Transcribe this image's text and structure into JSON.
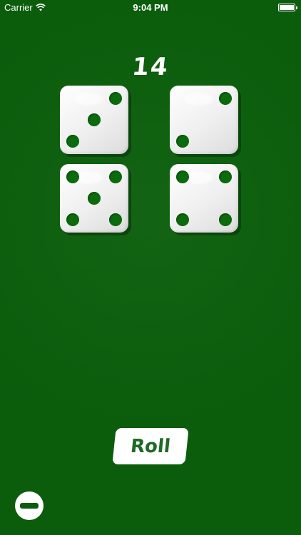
{
  "status_bar": {
    "carrier": "Carrier",
    "time": "9:04 PM",
    "wifi_icon": "wifi-icon",
    "battery_icon": "battery-icon"
  },
  "game": {
    "total": "14",
    "dice": [
      3,
      2,
      5,
      4
    ]
  },
  "controls": {
    "roll_label": "Roll",
    "remove_die_icon": "minus-icon"
  },
  "colors": {
    "felt_green": "#0b5f0c",
    "pip_green": "#0b6b0d",
    "roll_text": "#1f6a24"
  }
}
